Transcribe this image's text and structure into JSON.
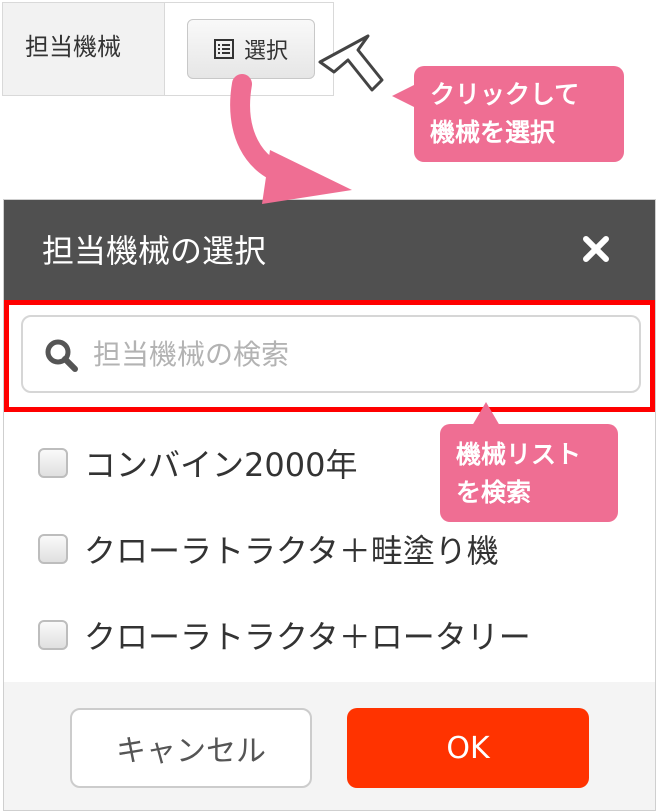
{
  "form": {
    "label": "担当機械",
    "select_button": {
      "icon": "list-icon",
      "label": "選択"
    }
  },
  "callouts": {
    "click_to_select": [
      "クリックして",
      "機械を選択"
    ],
    "search_list": [
      "機械リスト",
      "を検索"
    ]
  },
  "modal": {
    "title": "担当機械の選択",
    "close_icon": "close-icon",
    "search": {
      "icon": "search-icon",
      "placeholder": "担当機械の検索",
      "value": ""
    },
    "items": [
      {
        "label": "コンバイン2000年",
        "checked": false
      },
      {
        "label": "クローラトラクタ＋畦塗り機",
        "checked": false
      },
      {
        "label": "クローラトラクタ＋ロータリー",
        "checked": false
      }
    ],
    "buttons": {
      "cancel": "キャンセル",
      "ok": "OK"
    }
  },
  "colors": {
    "header_bg": "#505050",
    "callout": "#ef6e93",
    "highlight_frame": "#ff0000",
    "ok_button": "#ff3300"
  }
}
